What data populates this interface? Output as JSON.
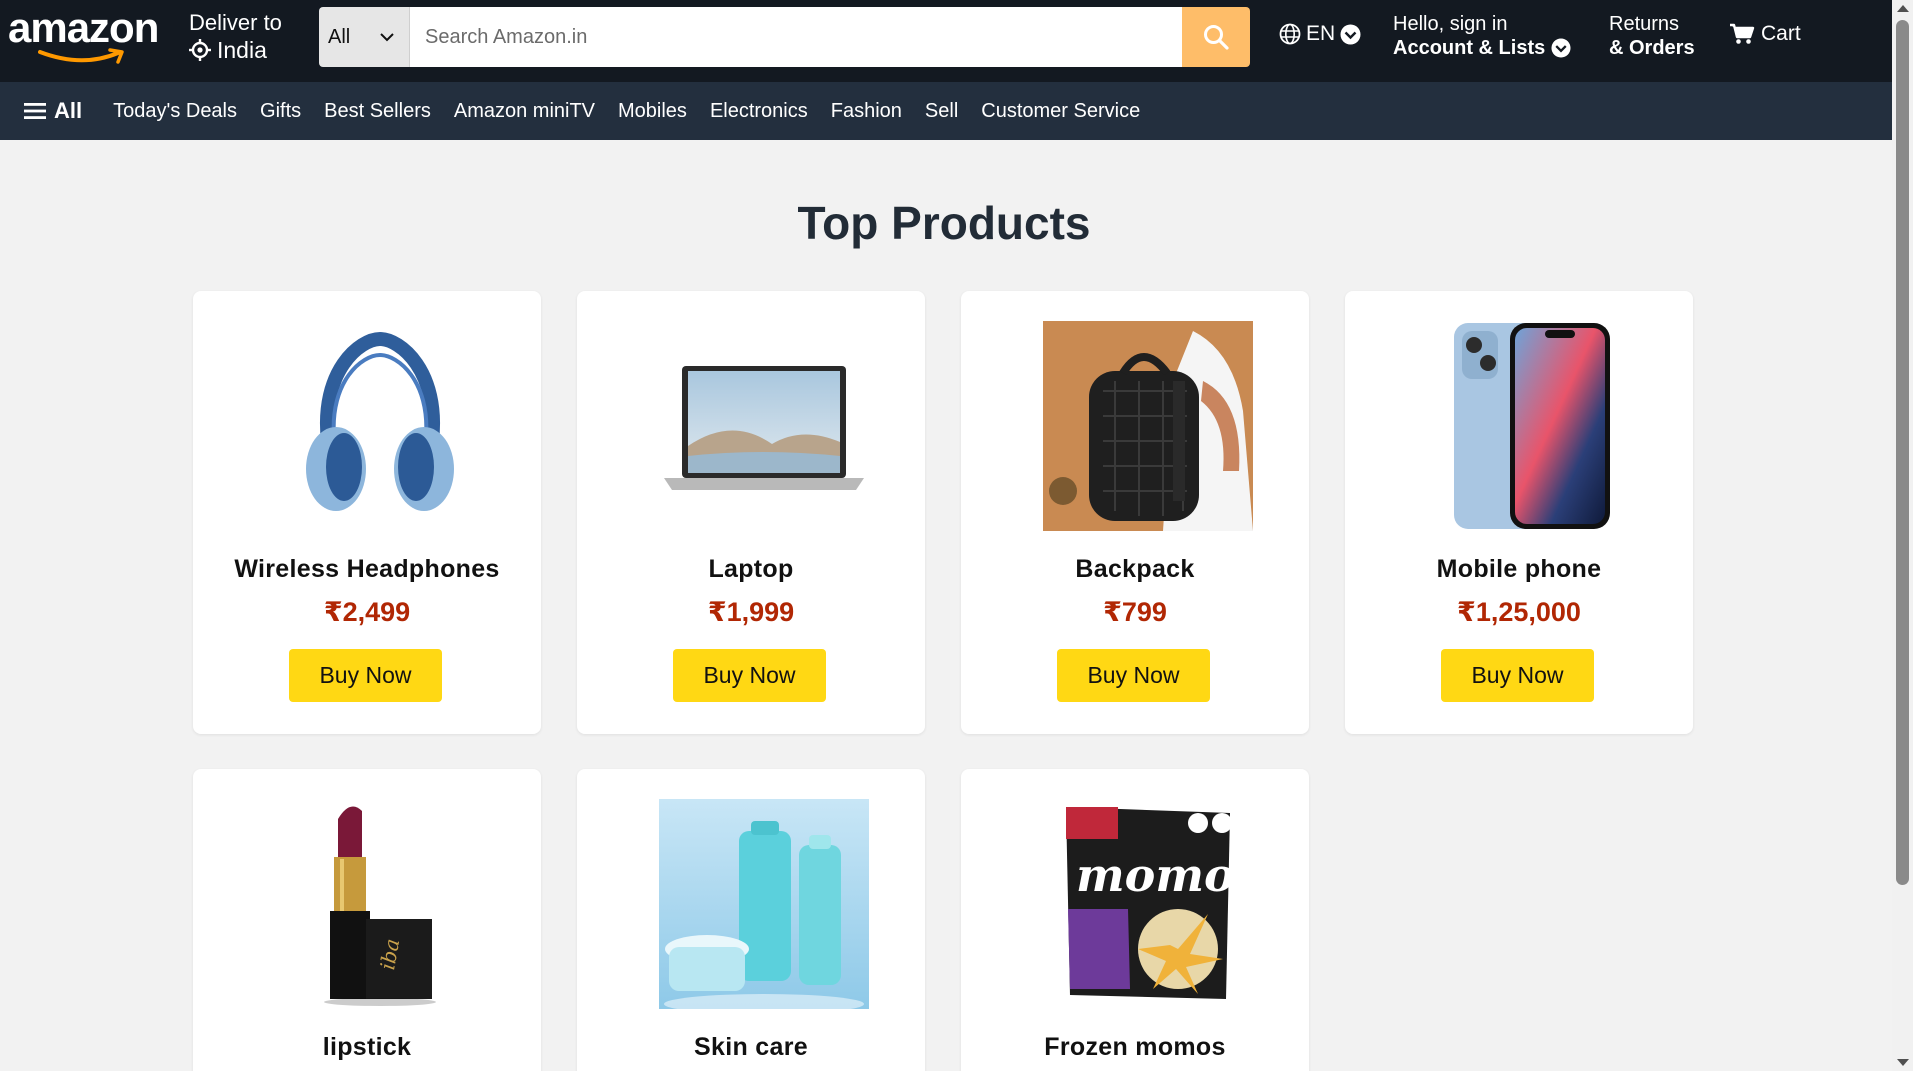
{
  "header": {
    "logo_text": "amazon",
    "deliver_line1": "Deliver to",
    "deliver_line2": "India",
    "search_category": "All",
    "search_placeholder": "Search Amazon.in",
    "language": "EN",
    "account_line1": "Hello, sign in",
    "account_line2": "Account & Lists",
    "returns_line1": "Returns",
    "returns_line2": "& Orders",
    "cart_label": "Cart"
  },
  "nav": {
    "all_label": "All",
    "items": [
      "Today's Deals",
      "Gifts",
      "Best Sellers",
      "Amazon miniTV",
      "Mobiles",
      "Electronics",
      "Fashion",
      "Sell",
      "Customer Service"
    ]
  },
  "main": {
    "title": "Top Products",
    "buy_label": "Buy Now",
    "products": [
      {
        "name": "Wireless Headphones",
        "price": "₹2,499",
        "image": "headphones-image"
      },
      {
        "name": "Laptop",
        "price": "₹1,999",
        "image": "laptop-image"
      },
      {
        "name": "Backpack",
        "price": "₹799",
        "image": "backpack-image"
      },
      {
        "name": "Mobile phone",
        "price": "₹1,25,000",
        "image": "phone-image"
      },
      {
        "name": "lipstick",
        "price": "",
        "image": "lipstick-image"
      },
      {
        "name": "Skin care",
        "price": "",
        "image": "skincare-image"
      },
      {
        "name": "Frozen momos",
        "price": "",
        "image": "momos-image"
      }
    ]
  },
  "colors": {
    "header_bg": "#131921",
    "nav_bg": "#232f3e",
    "search_button": "#febd69",
    "buy_button": "#ffd814",
    "price": "#b12704",
    "logo_arrow": "#ff9900"
  }
}
